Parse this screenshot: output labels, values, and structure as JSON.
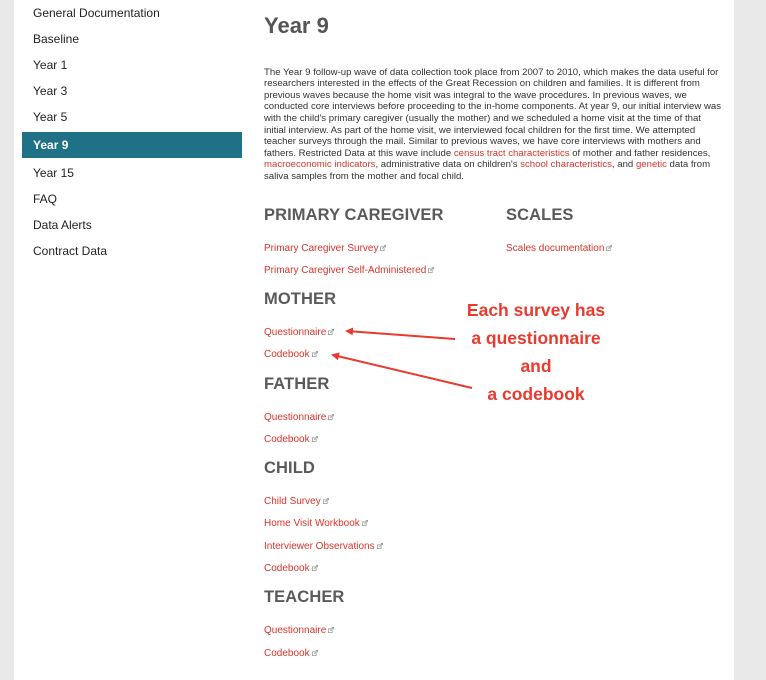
{
  "sidebar": {
    "items": [
      {
        "label": "General Documentation",
        "active": false
      },
      {
        "label": "Baseline",
        "active": false
      },
      {
        "label": "Year 1",
        "active": false
      },
      {
        "label": "Year 3",
        "active": false
      },
      {
        "label": "Year 5",
        "active": false
      },
      {
        "label": "Year 9",
        "active": true
      },
      {
        "label": "Year 15",
        "active": false
      },
      {
        "label": "FAQ",
        "active": false
      },
      {
        "label": "Data Alerts",
        "active": false
      },
      {
        "label": "Contract Data",
        "active": false
      }
    ]
  },
  "main": {
    "title": "Year 9",
    "intro": {
      "text1": "The Year 9 follow-up wave of data collection took place from 2007 to 2010, which makes the data useful for researchers interested in the effects of the Great Recession on children and families. It is different from previous waves because the home visit was integral to the wave procedures. In previous waves, we conducted core interviews before proceeding to the in-home components. At year 9, our initial interview was with the child's primary caregiver (usually the mother) and we scheduled a home visit at the time of that initial interview. As part of the home visit, we interviewed focal children for the first time. We attempted teacher surveys through the mail. Similar to previous waves, we have core interviews with mothers and fathers. Restricted Data at this wave include ",
      "link1": "census tract characteristics",
      "text2": " of mother and father residences, ",
      "link2": "macroeconomic indicators",
      "text3": ", administrative data on children's ",
      "link3": "school characteristics",
      "text4": ", and ",
      "link4": "genetic",
      "text5": " data from saliva samples from the mother and focal child."
    },
    "sections": {
      "primary_caregiver": {
        "title": "PRIMARY CAREGIVER",
        "links": [
          "Primary Caregiver Survey",
          "Primary Caregiver Self-Administered"
        ]
      },
      "scales": {
        "title": "SCALES",
        "links": [
          "Scales documentation"
        ]
      },
      "mother": {
        "title": "MOTHER",
        "links": [
          "Questionnaire",
          "Codebook"
        ]
      },
      "father": {
        "title": "FATHER",
        "links": [
          "Questionnaire",
          "Codebook"
        ]
      },
      "child": {
        "title": "CHILD",
        "links": [
          "Child Survey",
          "Home Visit Workbook",
          "Interviewer Observations",
          "Codebook"
        ]
      },
      "teacher": {
        "title": "TEACHER",
        "links": [
          "Questionnaire",
          "Codebook"
        ]
      }
    }
  },
  "annotation": {
    "lines": [
      "Each survey has",
      "a questionnaire",
      "and",
      "a codebook"
    ],
    "color": "#e83a2e"
  },
  "colors": {
    "accent": "#1f7285",
    "link": "#d9342a"
  }
}
